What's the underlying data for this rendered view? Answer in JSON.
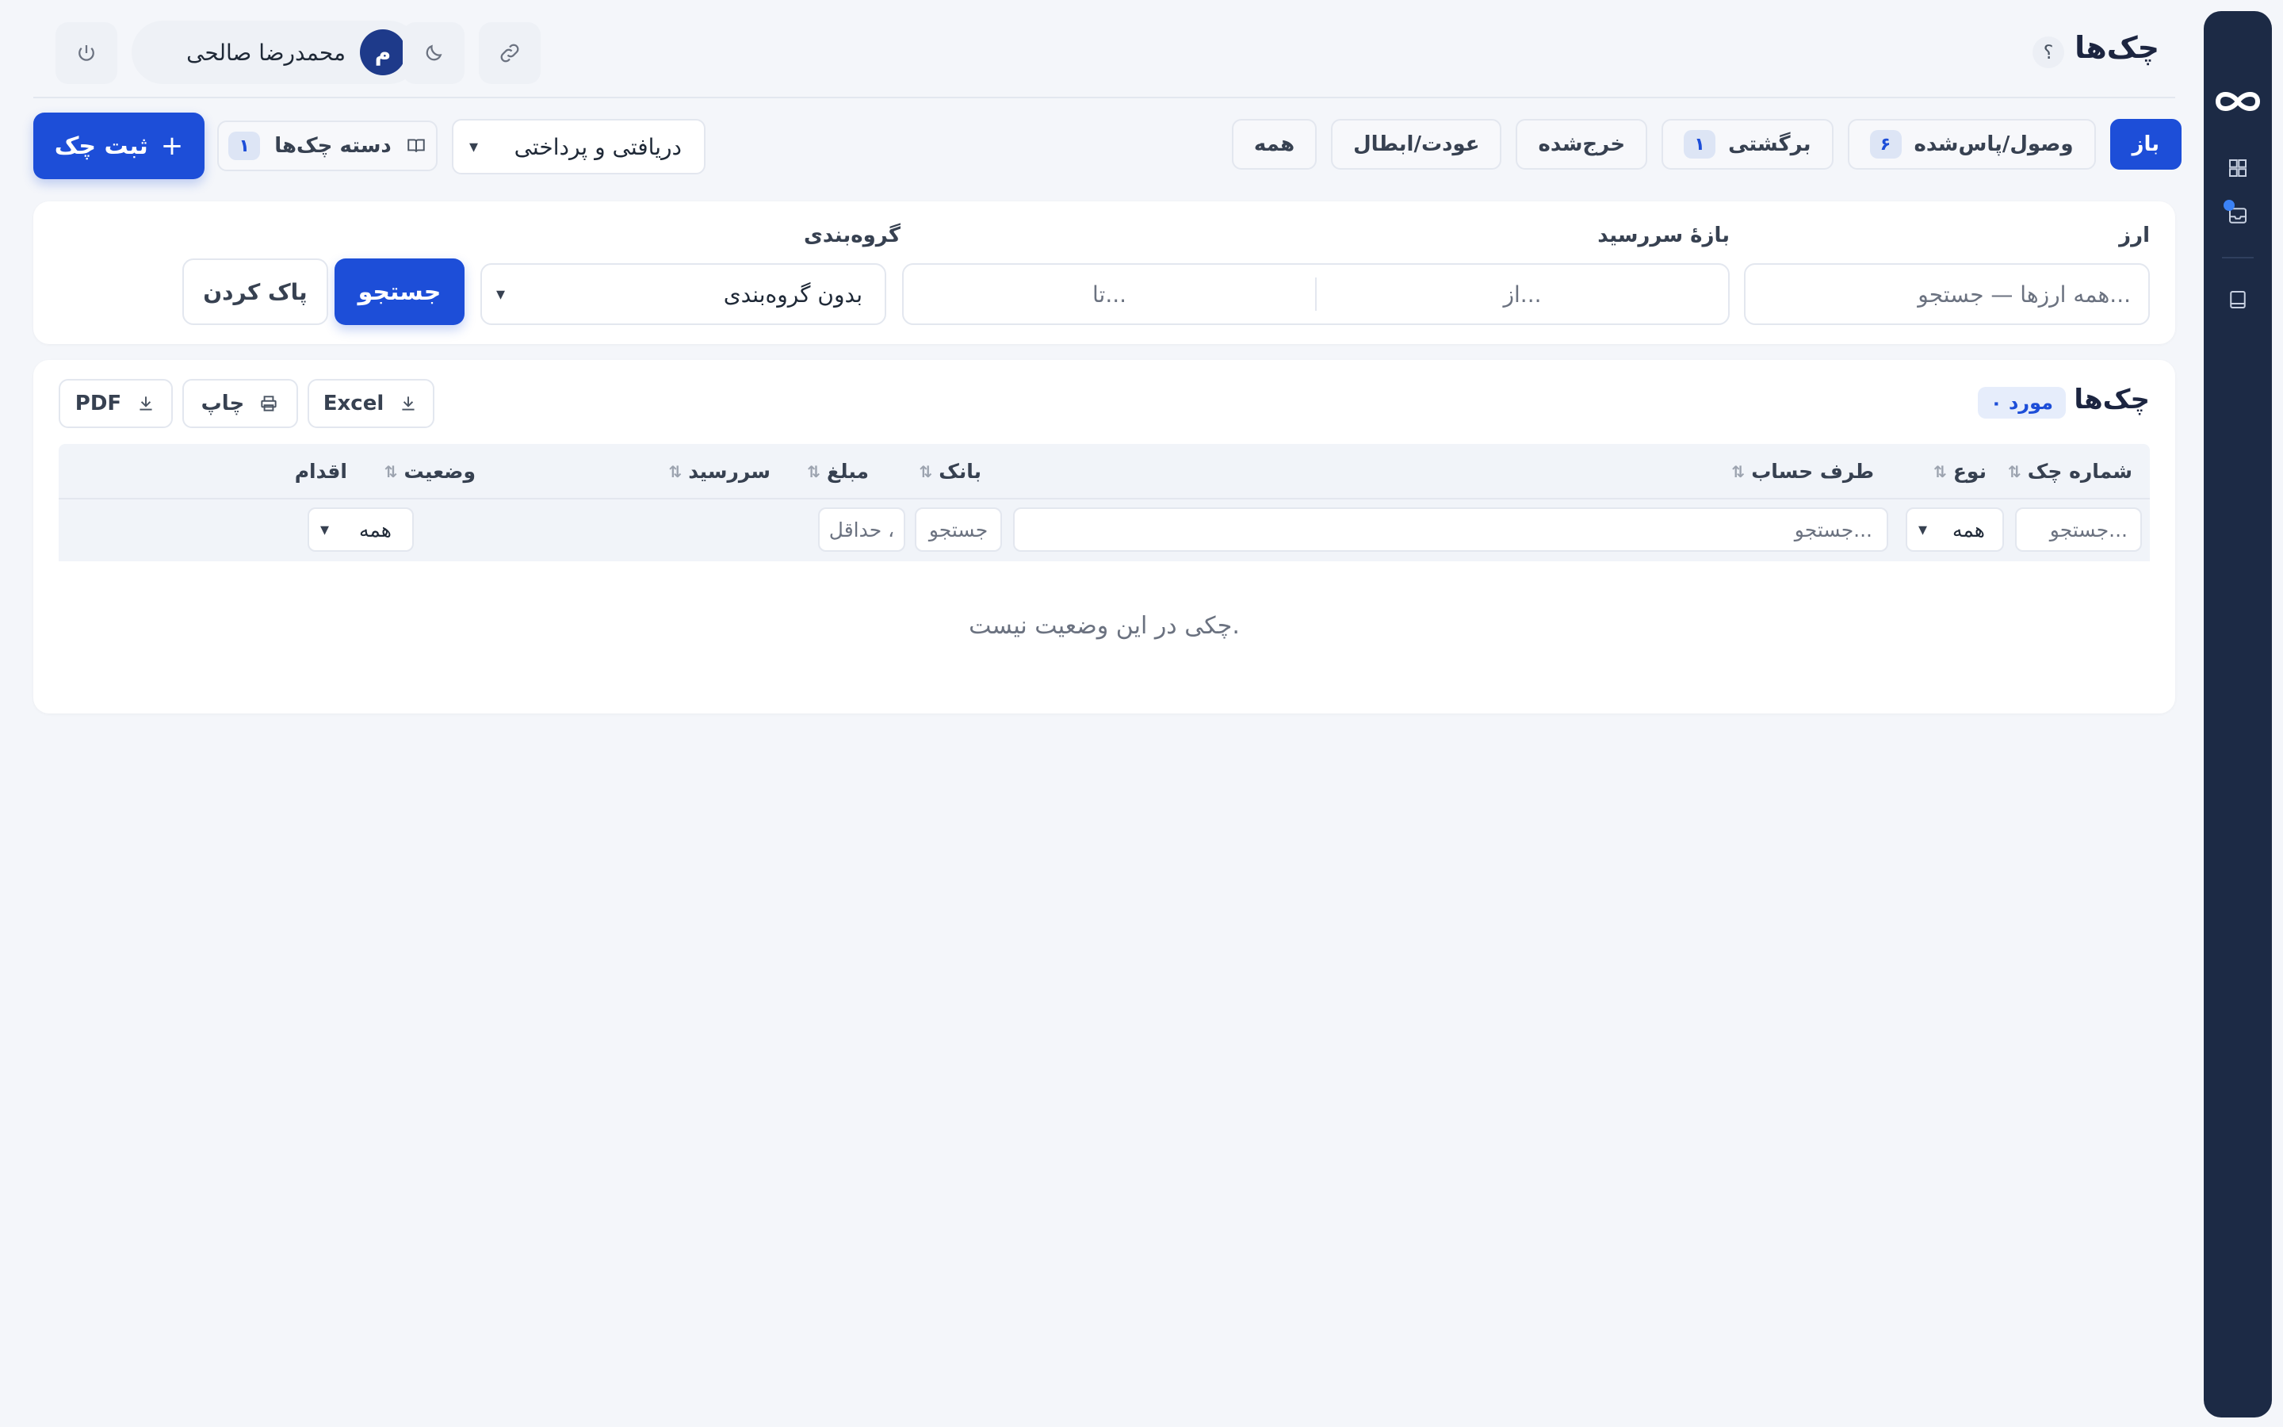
{
  "header": {
    "title": "چک‌ها",
    "help": "؟",
    "user_name": "محمدرضا صالحی",
    "avatar_letter": "م"
  },
  "tabs": [
    {
      "label": "باز",
      "badge": "",
      "active": true
    },
    {
      "label": "وصول/پاس‌شده",
      "badge": "۶"
    },
    {
      "label": "برگشتی",
      "badge": "۱"
    },
    {
      "label": "خرج‌شده",
      "badge": ""
    },
    {
      "label": "عودت/ابطال",
      "badge": ""
    },
    {
      "label": "همه",
      "badge": ""
    }
  ],
  "toolbar": {
    "add_label": "ثبت چک",
    "books_label": "دسته چک‌ها",
    "books_badge": "۱",
    "type_value": "دریافتی و پرداختی"
  },
  "filters": {
    "currency_label": "ارز",
    "currency_placeholder": "همه ارزها — جستجو...",
    "due_label": "بازهٔ سررسید",
    "from_placeholder": "از...",
    "to_placeholder": "تا...",
    "group_label": "گروه‌بندی",
    "group_value": "بدون گروه‌بندی",
    "search_label": "جستجو",
    "clear_label": "پاک کردن"
  },
  "table": {
    "title": "چک‌ها",
    "count": "۰ مورد",
    "excel": "Excel",
    "print": "چاپ",
    "pdf": "PDF",
    "columns": {
      "number": "شماره چک",
      "type": "نوع",
      "party": "طرف حساب",
      "bank": "بانک",
      "amount": "مبلغ",
      "due": "سررسید",
      "status": "وضعیت",
      "action": "اقدام"
    },
    "filter_row": {
      "number_ph": "جستجو...",
      "type_val": "همه",
      "party_ph": "جستجو...",
      "bank_ph": "جستجو",
      "amount_ph": "حداقل ،",
      "status_val": "همه"
    },
    "empty": "چکی در این وضعیت نیست."
  }
}
